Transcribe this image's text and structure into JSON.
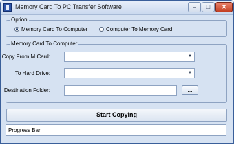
{
  "window": {
    "title": "Memory Card To PC Transfer Software",
    "minimize_label": "–",
    "maximize_label": "□",
    "close_label": "✕"
  },
  "option_group": {
    "title": "Option",
    "radios": [
      {
        "label": "Memory Card To Computer",
        "selected": true
      },
      {
        "label": "Computer To Memory Card",
        "selected": false
      }
    ]
  },
  "transfer_group": {
    "title": "Memory Card To Computer",
    "copy_from_label": "Copy From M Card:",
    "copy_from_value": "",
    "to_drive_label": "To Hard Drive:",
    "to_drive_value": "",
    "destination_label": "Destination Folder:",
    "destination_value": "",
    "browse_label": "...",
    "dropdown_arrow": "▼"
  },
  "start_button_label": "Start Copying",
  "progress_bar_text": "Progress Bar"
}
